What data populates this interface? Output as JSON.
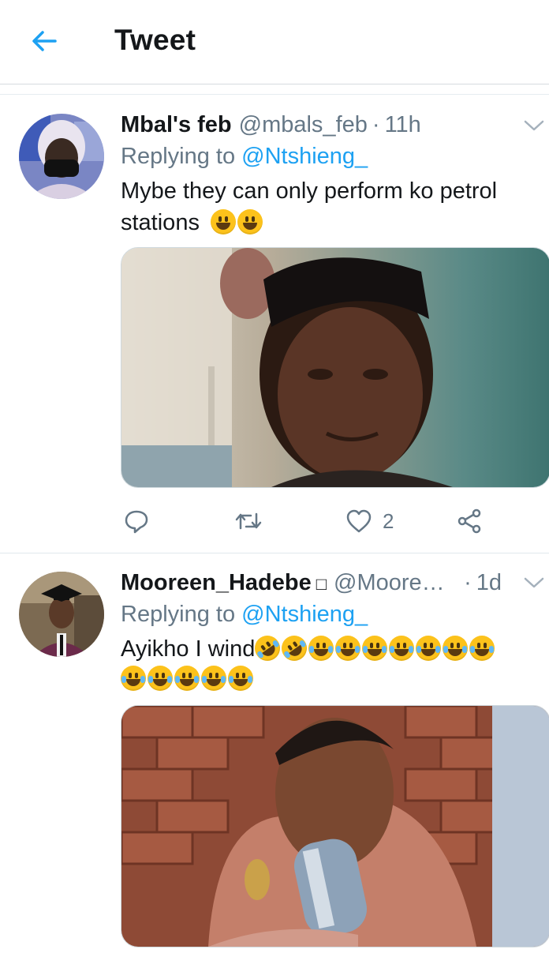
{
  "header": {
    "title": "Tweet"
  },
  "tweets": [
    {
      "display_name": "Mbal's feb",
      "handle": "@mbals_feb",
      "separator": "·",
      "time": "11h",
      "replying_label": "Replying to",
      "replying_to": "@Ntshieng_",
      "text_line1": "Mybe they can only perform ko petrol",
      "text_line2": "stations",
      "like_count": "2"
    },
    {
      "display_name": "Mooreen_Hadebe",
      "name_symbol": "□",
      "handle": "@Mooreen...",
      "separator": "·",
      "time": "1d",
      "replying_label": "Replying to",
      "replying_to": "@Ntshieng_",
      "text_line1": "Ayikho I wind"
    }
  ],
  "colors": {
    "accent": "#1da1f2",
    "secondary_text": "#657786",
    "divider": "#e1e8ed"
  },
  "icons": [
    "back-arrow-icon",
    "chevron-down-icon",
    "reply-icon",
    "retweet-icon",
    "like-icon",
    "share-icon"
  ]
}
